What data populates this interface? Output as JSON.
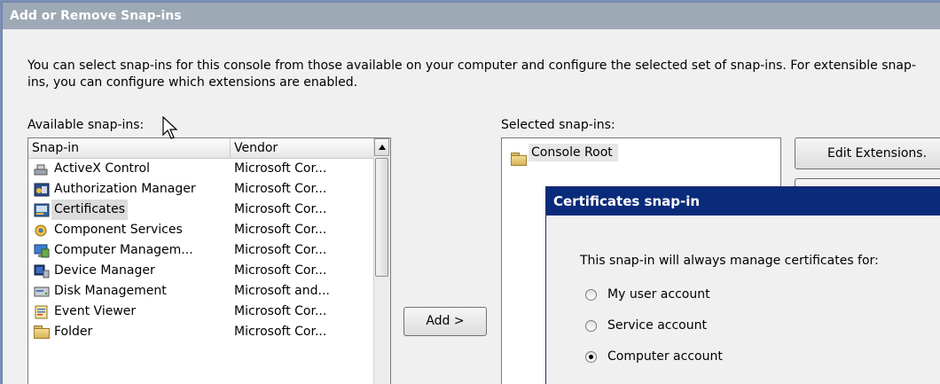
{
  "window": {
    "title": "Add or Remove Snap-ins"
  },
  "description": "You can select snap-ins for this console from those available on your computer and configure the selected set of snap-ins. For extensible snap-ins, you can configure which extensions are enabled.",
  "available": {
    "label": "Available snap-ins:",
    "columns": [
      "Snap-in",
      "Vendor"
    ],
    "rows": [
      {
        "name": "ActiveX Control",
        "vendor": "Microsoft Cor...",
        "icon": "activex-icon"
      },
      {
        "name": "Authorization Manager",
        "vendor": "Microsoft Cor...",
        "icon": "authorization-icon"
      },
      {
        "name": "Certificates",
        "vendor": "Microsoft Cor...",
        "icon": "certificates-icon",
        "selected": true
      },
      {
        "name": "Component Services",
        "vendor": "Microsoft Cor...",
        "icon": "component-services-icon"
      },
      {
        "name": "Computer Managem...",
        "vendor": "Microsoft Cor...",
        "icon": "computer-management-icon"
      },
      {
        "name": "Device Manager",
        "vendor": "Microsoft Cor...",
        "icon": "device-manager-icon"
      },
      {
        "name": "Disk Management",
        "vendor": "Microsoft and...",
        "icon": "disk-management-icon"
      },
      {
        "name": "Event Viewer",
        "vendor": "Microsoft Cor...",
        "icon": "event-viewer-icon"
      },
      {
        "name": "Folder",
        "vendor": "Microsoft Cor...",
        "icon": "folder-icon"
      }
    ]
  },
  "add_button": "Add >",
  "selected": {
    "label": "Selected snap-ins:",
    "root": "Console Root"
  },
  "edit_extensions_button": "Edit Extensions.",
  "dialog": {
    "title": "Certificates snap-in",
    "prompt": "This snap-in will always manage certificates for:",
    "options": [
      {
        "label": "My user account",
        "checked": false
      },
      {
        "label": "Service account",
        "checked": false
      },
      {
        "label": "Computer account",
        "checked": true
      }
    ]
  }
}
